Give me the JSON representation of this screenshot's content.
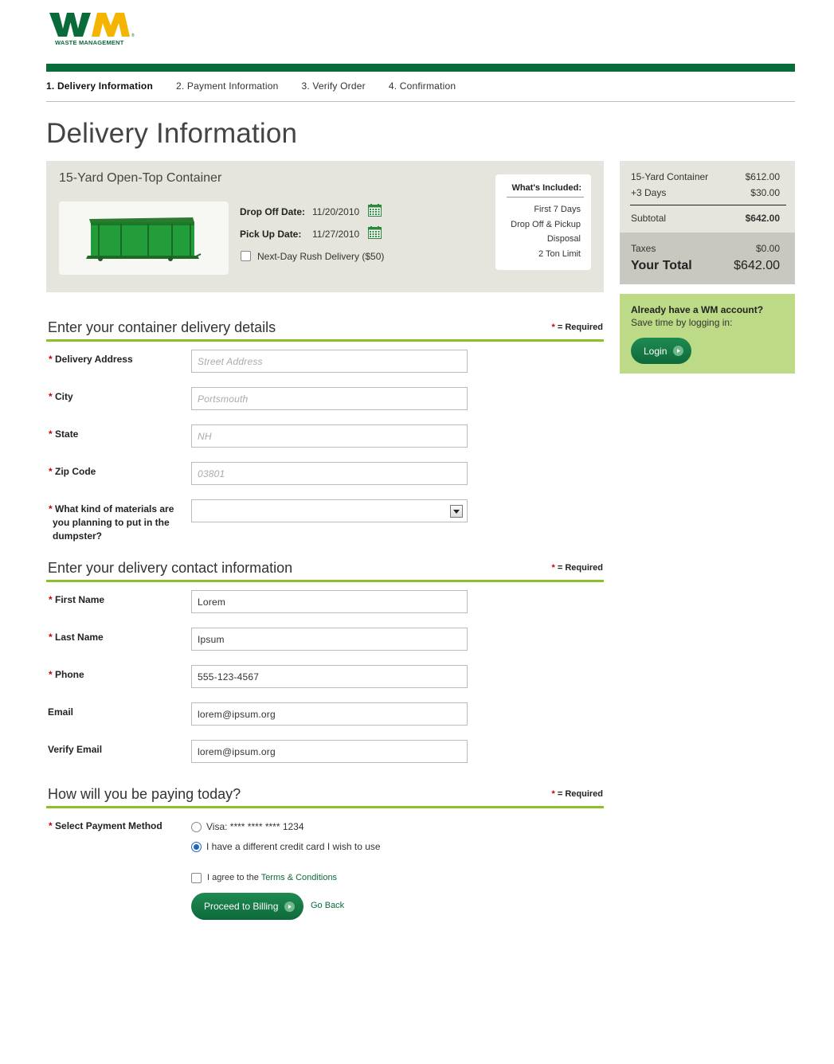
{
  "brand": {
    "logo_letters": "WM",
    "logo_text": "WASTE MANAGEMENT",
    "primary_green": "#0a6b3a",
    "accent_green": "#8cbf2a",
    "logo_yellow": "#f5b400"
  },
  "steps": [
    {
      "label": "1. Delivery Information",
      "active": true
    },
    {
      "label": "2. Payment Information"
    },
    {
      "label": "3. Verify Order"
    },
    {
      "label": "4. Confirmation"
    }
  ],
  "page_title": "Delivery Information",
  "product": {
    "title": "15-Yard Open-Top Container",
    "drop_off_label": "Drop Off Date:",
    "drop_off_value": "11/20/2010",
    "pick_up_label": "Pick Up  Date:",
    "pick_up_value": "11/27/2010",
    "rush_label": "Next-Day Rush Delivery ($50)",
    "included_title": "What's Included:",
    "included_items": [
      "First 7 Days",
      "Drop Off & Pickup",
      "Disposal",
      "2 Ton Limit"
    ]
  },
  "summary": {
    "rows": [
      {
        "label": "15-Yard Container",
        "value": "$612.00"
      },
      {
        "label": "+3 Days",
        "value": "$30.00"
      }
    ],
    "subtotal_label": "Subtotal",
    "subtotal_value": "$642.00",
    "taxes_label": "Taxes",
    "taxes_value": "$0.00",
    "total_label": "Your Total",
    "total_value": "$642.00"
  },
  "login": {
    "title": "Already have a WM account?",
    "subtitle": "Save time by logging in:",
    "button": "Login"
  },
  "required_star": "*",
  "required_text": " = Required",
  "delivery_section": {
    "title": "Enter your container delivery details",
    "fields": [
      {
        "label": "Delivery Address",
        "placeholder": "Street Address"
      },
      {
        "label": "City",
        "placeholder": "Portsmouth"
      },
      {
        "label": "State",
        "placeholder": "NH"
      },
      {
        "label": "Zip Code",
        "placeholder": "03801"
      }
    ],
    "materials_label": "What kind of materials are you  planning to put in the dumpster?"
  },
  "contact_section": {
    "title": "Enter your delivery contact information",
    "fields": [
      {
        "label": "First Name",
        "value": "Lorem",
        "required": true
      },
      {
        "label": "Last Name",
        "value": "Ipsum",
        "required": true
      },
      {
        "label": "Phone",
        "value": "555-123-4567",
        "required": true
      },
      {
        "label": "Email",
        "value": "lorem@ipsum.org",
        "required": false
      },
      {
        "label": "Verify Email",
        "value": "lorem@ipsum.org",
        "required": false
      }
    ]
  },
  "payment_section": {
    "title": "How will you be paying today?",
    "method_label": "Select Payment Method",
    "options": [
      {
        "label": "Visa: **** **** **** 1234",
        "selected": false
      },
      {
        "label": "I have a different credit card I wish to use",
        "selected": true
      }
    ],
    "agree_prefix": "I agree to the ",
    "agree_link": "Terms & Conditions",
    "proceed_button": "Proceed to Billing",
    "go_back": "Go Back"
  }
}
